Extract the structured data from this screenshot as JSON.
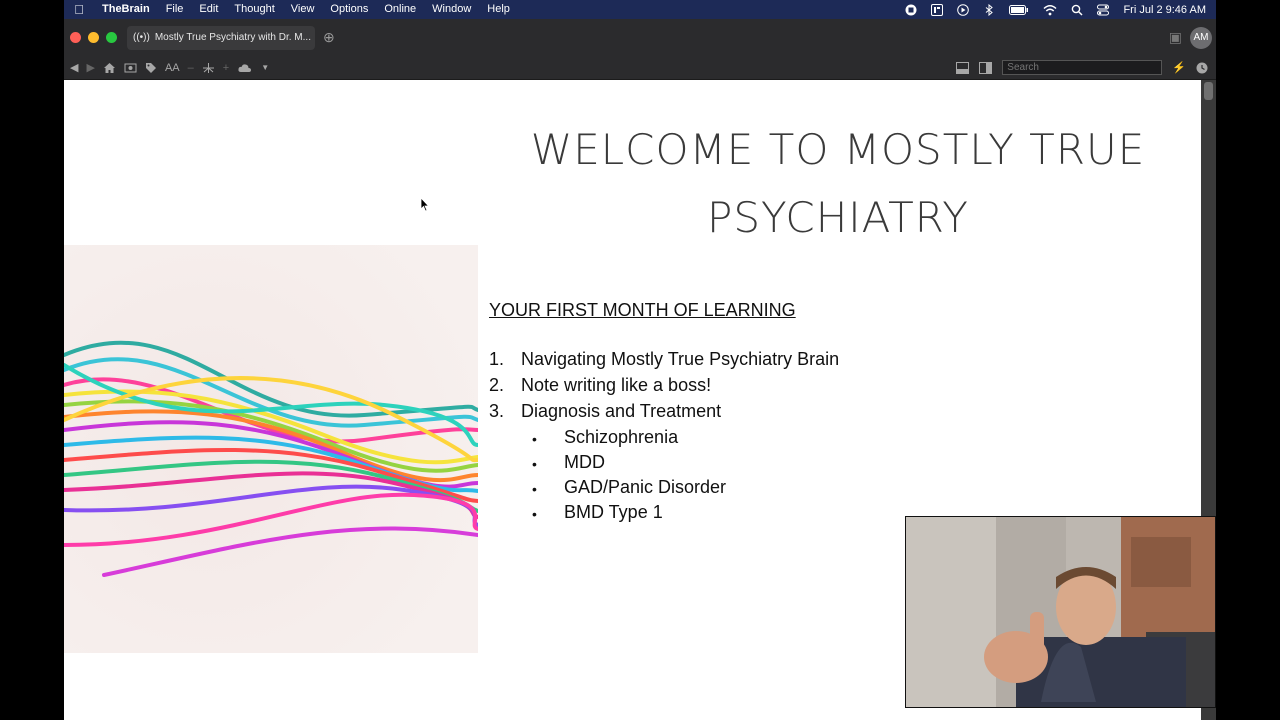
{
  "menubar": {
    "app_name": "TheBrain",
    "items": [
      "File",
      "Edit",
      "Thought",
      "View",
      "Options",
      "Online",
      "Window",
      "Help"
    ],
    "clock": "Fri Jul 2  9:46 AM"
  },
  "titlebar": {
    "tab_title": "Mostly True Psychiatry with Dr. M...",
    "avatar_initials": "AM"
  },
  "toolbar": {
    "font_label": "AA",
    "search_placeholder": "Search"
  },
  "slide": {
    "title_line1": "WELCOME TO MOSTLY TRUE",
    "title_line2": "PSYCHIATRY",
    "subheading": "YOUR FIRST MONTH OF LEARNING",
    "numbered": [
      {
        "num": "1.",
        "text": "Navigating Mostly True Psychiatry Brain"
      },
      {
        "num": "2.",
        "text": "Note writing like a boss!"
      },
      {
        "num": "3.",
        "text": "Diagnosis and Treatment"
      }
    ],
    "bullets": [
      "Schizophrenia",
      "MDD",
      "GAD/Panic Disorder",
      "BMD Type 1"
    ],
    "bullet_glyph": "•"
  },
  "colors": {
    "menubar_bg": "#1d2a57",
    "chrome_bg": "#2b2b2d",
    "slide_bg": "#ffffff",
    "title_text": "#3a3a3a"
  }
}
